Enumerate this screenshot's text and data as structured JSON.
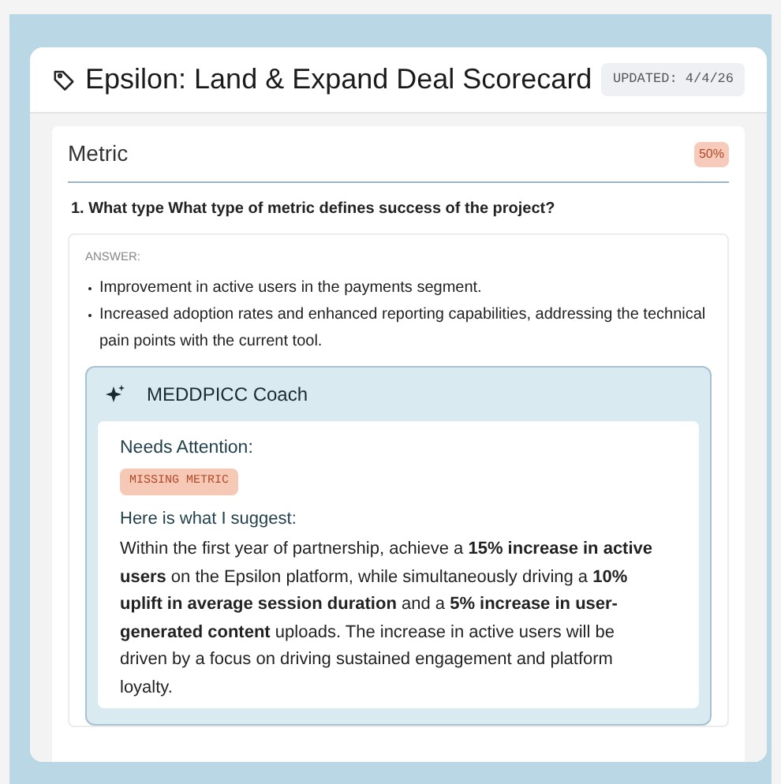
{
  "header": {
    "title": "Epsilon: Land & Expand Deal Scorecard",
    "updated": "UPDATED: 4/4/26"
  },
  "section": {
    "title": "Metric",
    "score": "50%"
  },
  "question": "1. What type What type of metric defines success of the project?",
  "answer": {
    "label": "ANSWER:",
    "bullets": [
      "Improvement in active users in the payments segment.",
      "Increased adoption rates and enhanced reporting capabilities, addressing the technical pain points with the current tool."
    ]
  },
  "coach": {
    "title": "MEDDPICC Coach",
    "attention_label": "Needs Attention:",
    "tags": [
      "MISSING METRIC"
    ],
    "suggest_label": "Here is what I suggest:",
    "suggestion": "Within the first year of partnership, achieve a **15% increase in active users** on the Epsilon platform, while simultaneously driving a **10% uplift in average session duration** and a **5% increase in user-generated content** uploads. The increase in active users will be driven by a focus on driving sustained engagement and platform loyalty."
  }
}
